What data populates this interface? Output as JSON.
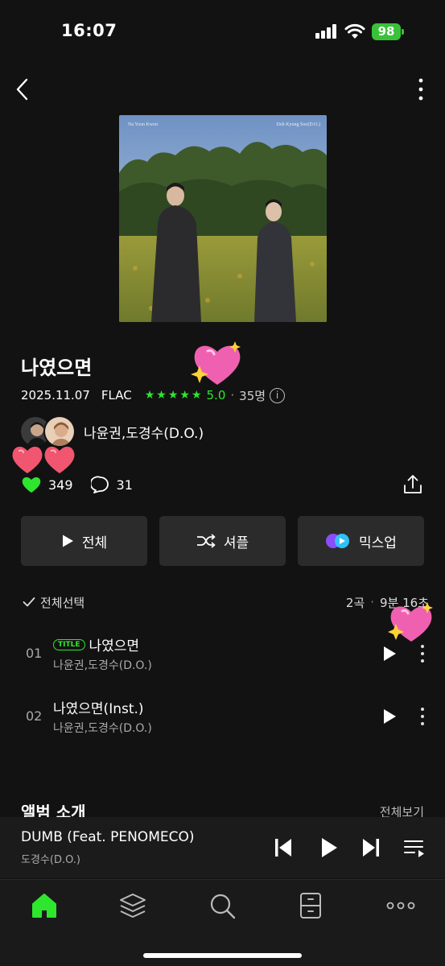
{
  "status_bar": {
    "time": "16:07",
    "battery": "98"
  },
  "album": {
    "title": "나였으면",
    "cover_credit_left": "Na Yoon Kwon",
    "cover_credit_right": "Doh Kyung Soo(D.O.)",
    "release_date": "2025.11.07",
    "format": "FLAC",
    "rating": "5.0",
    "rating_stars": 5,
    "rating_count": "35명",
    "artists": "나윤권,도경수(D.O.)",
    "likes": "349",
    "comments": "31"
  },
  "actions": {
    "play_all": "전체",
    "shuffle": "셔플",
    "mixup": "믹스업"
  },
  "tracklist": {
    "select_all": "전체선택",
    "track_count": "2곡",
    "total_time": "9분 16초",
    "tracks": [
      {
        "number": "01",
        "badge": "TITLE",
        "title": "나였으면",
        "artist": "나윤권,도경수(D.O.)"
      },
      {
        "number": "02",
        "badge": "",
        "title": "나였으면(Inst.)",
        "artist": "나윤권,도경수(D.O.)"
      }
    ]
  },
  "intro_section": {
    "title": "앨범 소개",
    "see_all": "전체보기"
  },
  "mini_player": {
    "title": "DUMB (Feat. PENOMECO)",
    "artist": "도경수(D.O.)"
  },
  "bottom_nav": {
    "items": [
      {
        "icon": "home-icon",
        "active": true
      },
      {
        "icon": "layers-icon",
        "active": false
      },
      {
        "icon": "search-icon",
        "active": false
      },
      {
        "icon": "library-drawer-icon",
        "active": false
      },
      {
        "icon": "more-dots-icon",
        "active": false
      }
    ]
  },
  "colors": {
    "accent": "#2ee62e",
    "background": "#121212",
    "button": "#2b2b2b"
  }
}
